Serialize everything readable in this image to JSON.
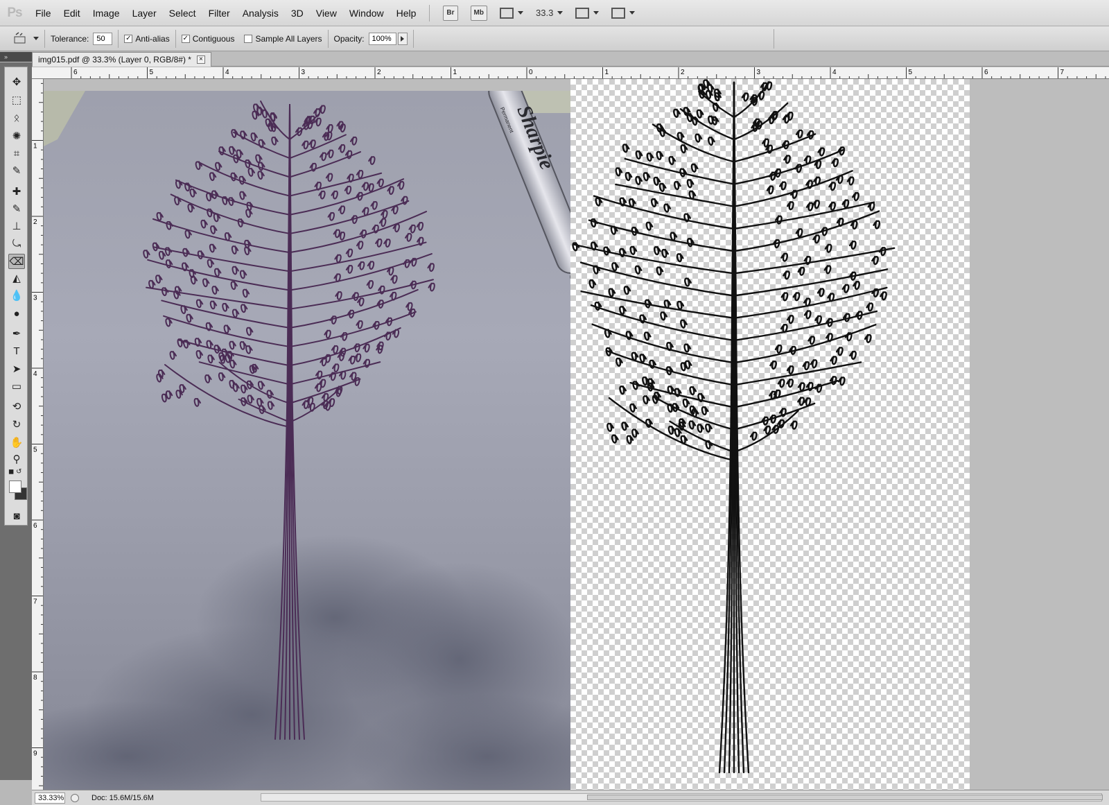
{
  "app": {
    "logo": "Ps"
  },
  "menu": {
    "items": [
      "File",
      "Edit",
      "Image",
      "Layer",
      "Select",
      "Filter",
      "Analysis",
      "3D",
      "View",
      "Window",
      "Help"
    ],
    "bridge_label": "Br",
    "minibridge_label": "Mb",
    "zoom_value": "33.3"
  },
  "options": {
    "tolerance_label": "Tolerance:",
    "tolerance_value": "50",
    "antialias_label": "Anti-alias",
    "antialias_checked": true,
    "contiguous_label": "Contiguous",
    "contiguous_checked": true,
    "sample_all_label": "Sample All Layers",
    "sample_all_checked": false,
    "opacity_label": "Opacity:",
    "opacity_value": "100%"
  },
  "document": {
    "tab_title": "img015.pdf @ 33.3% (Layer 0, RGB/8#) *",
    "close_glyph": "×"
  },
  "rulers": {
    "top_labels": [
      "6",
      "5",
      "4",
      "3",
      "2",
      "1",
      "0",
      "1",
      "2",
      "3",
      "4",
      "5",
      "6",
      "7"
    ],
    "left_labels": [
      "1",
      "2",
      "3",
      "4",
      "5",
      "6",
      "7",
      "8",
      "9"
    ]
  },
  "photo_text": {
    "marker_brand": "Sharpie",
    "marker_sub": "Permanent"
  },
  "status": {
    "zoom": "33.33%",
    "doc_info": "Doc: 15.6M/15.6M"
  },
  "colors": {
    "menubar": "#dcdcdc",
    "toolbox": "#6e6e6e",
    "canvas_bg": "#bdbdbd",
    "ink_purple": "#4b2c55",
    "ink_black": "#111111"
  },
  "tools": [
    "move-tool-icon",
    "marquee-tool-icon",
    "lasso-tool-icon",
    "quick-select-tool-icon",
    "crop-tool-icon",
    "eyedropper-tool-icon",
    "healing-brush-tool-icon",
    "brush-tool-icon",
    "clone-stamp-tool-icon",
    "history-brush-tool-icon",
    "magic-eraser-tool-icon",
    "paint-bucket-tool-icon",
    "blur-tool-icon",
    "dodge-tool-icon",
    "pen-tool-icon",
    "type-tool-icon",
    "path-select-tool-icon",
    "rectangle-tool-icon",
    "3d-rotate-tool-icon",
    "3d-orbit-tool-icon",
    "hand-tool-icon",
    "zoom-tool-icon",
    "quick-mask-icon"
  ]
}
